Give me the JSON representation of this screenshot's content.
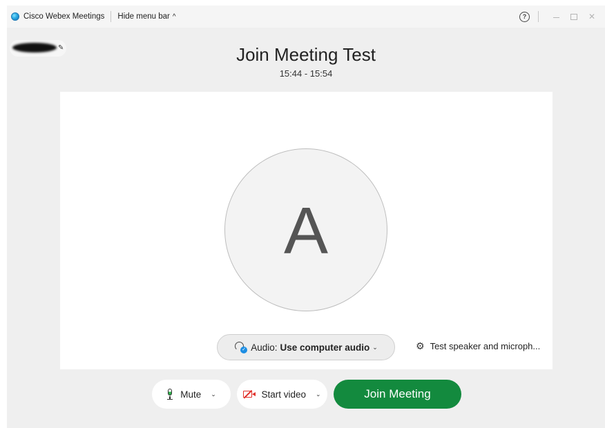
{
  "titlebar": {
    "app_name": "Cisco Webex Meetings",
    "hide_menu_label": "Hide menu bar",
    "hide_menu_chevron": "^",
    "help_icon": "?"
  },
  "header": {
    "meeting_title": "Join Meeting Test",
    "meeting_time": "15:44 - 15:54"
  },
  "preview": {
    "avatar_letter": "A",
    "audio": {
      "label": "Audio:",
      "value": "Use computer audio"
    },
    "test_speaker_label": "Test speaker and microph..."
  },
  "controls": {
    "mute_label": "Mute",
    "start_video_label": "Start video",
    "join_label": "Join Meeting"
  },
  "colors": {
    "join_button": "#138a3e",
    "video_off_icon": "#e0302a",
    "mic_level": "#2fb04c",
    "audio_check": "#1d8ee3"
  },
  "icons": {
    "app_logo": "webex-logo-icon",
    "help": "help-icon",
    "edit": "pencil-icon",
    "audio": "headset-check-icon",
    "settings": "gear-icon",
    "mic": "microphone-icon",
    "video": "video-off-icon"
  }
}
